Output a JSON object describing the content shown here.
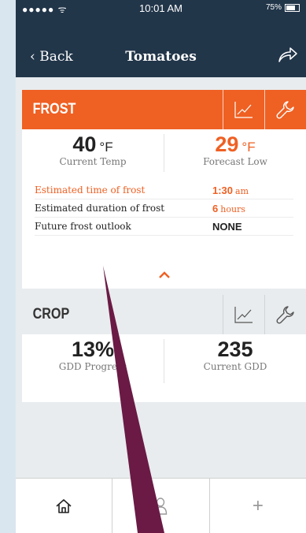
{
  "status": {
    "signal": "●●●●● ᯤ",
    "time": "10:01 AM",
    "battery": "75%"
  },
  "nav": {
    "back": "Back",
    "title": "Tomatoes"
  },
  "frost": {
    "title": "FROST",
    "current_temp": "40",
    "current_unit": "°F",
    "current_label": "Current Temp",
    "forecast_low": "29",
    "forecast_unit": "°F",
    "forecast_label": "Forecast Low",
    "rows": [
      {
        "label": "Estimated time of frost",
        "value": "1:30",
        "suffix": "am"
      },
      {
        "label": "Estimated duration of frost",
        "value": "6",
        "suffix": "hours"
      },
      {
        "label": "Future frost outlook",
        "value": "NONE",
        "suffix": ""
      }
    ]
  },
  "crop": {
    "title": "CROP",
    "gdd_progress": "13%",
    "gdd_progress_label": "GDD Progress",
    "current_gdd": "235",
    "current_gdd_label": "Current GDD"
  },
  "colors": {
    "navy": "#22364a",
    "orange": "#ef6023",
    "pointer": "#6a1a45"
  },
  "icons": [
    "back-chevron-icon",
    "share-icon",
    "chart-icon",
    "wrench-icon",
    "chevron-up-icon",
    "home-icon",
    "person-icon",
    "plus-icon"
  ]
}
